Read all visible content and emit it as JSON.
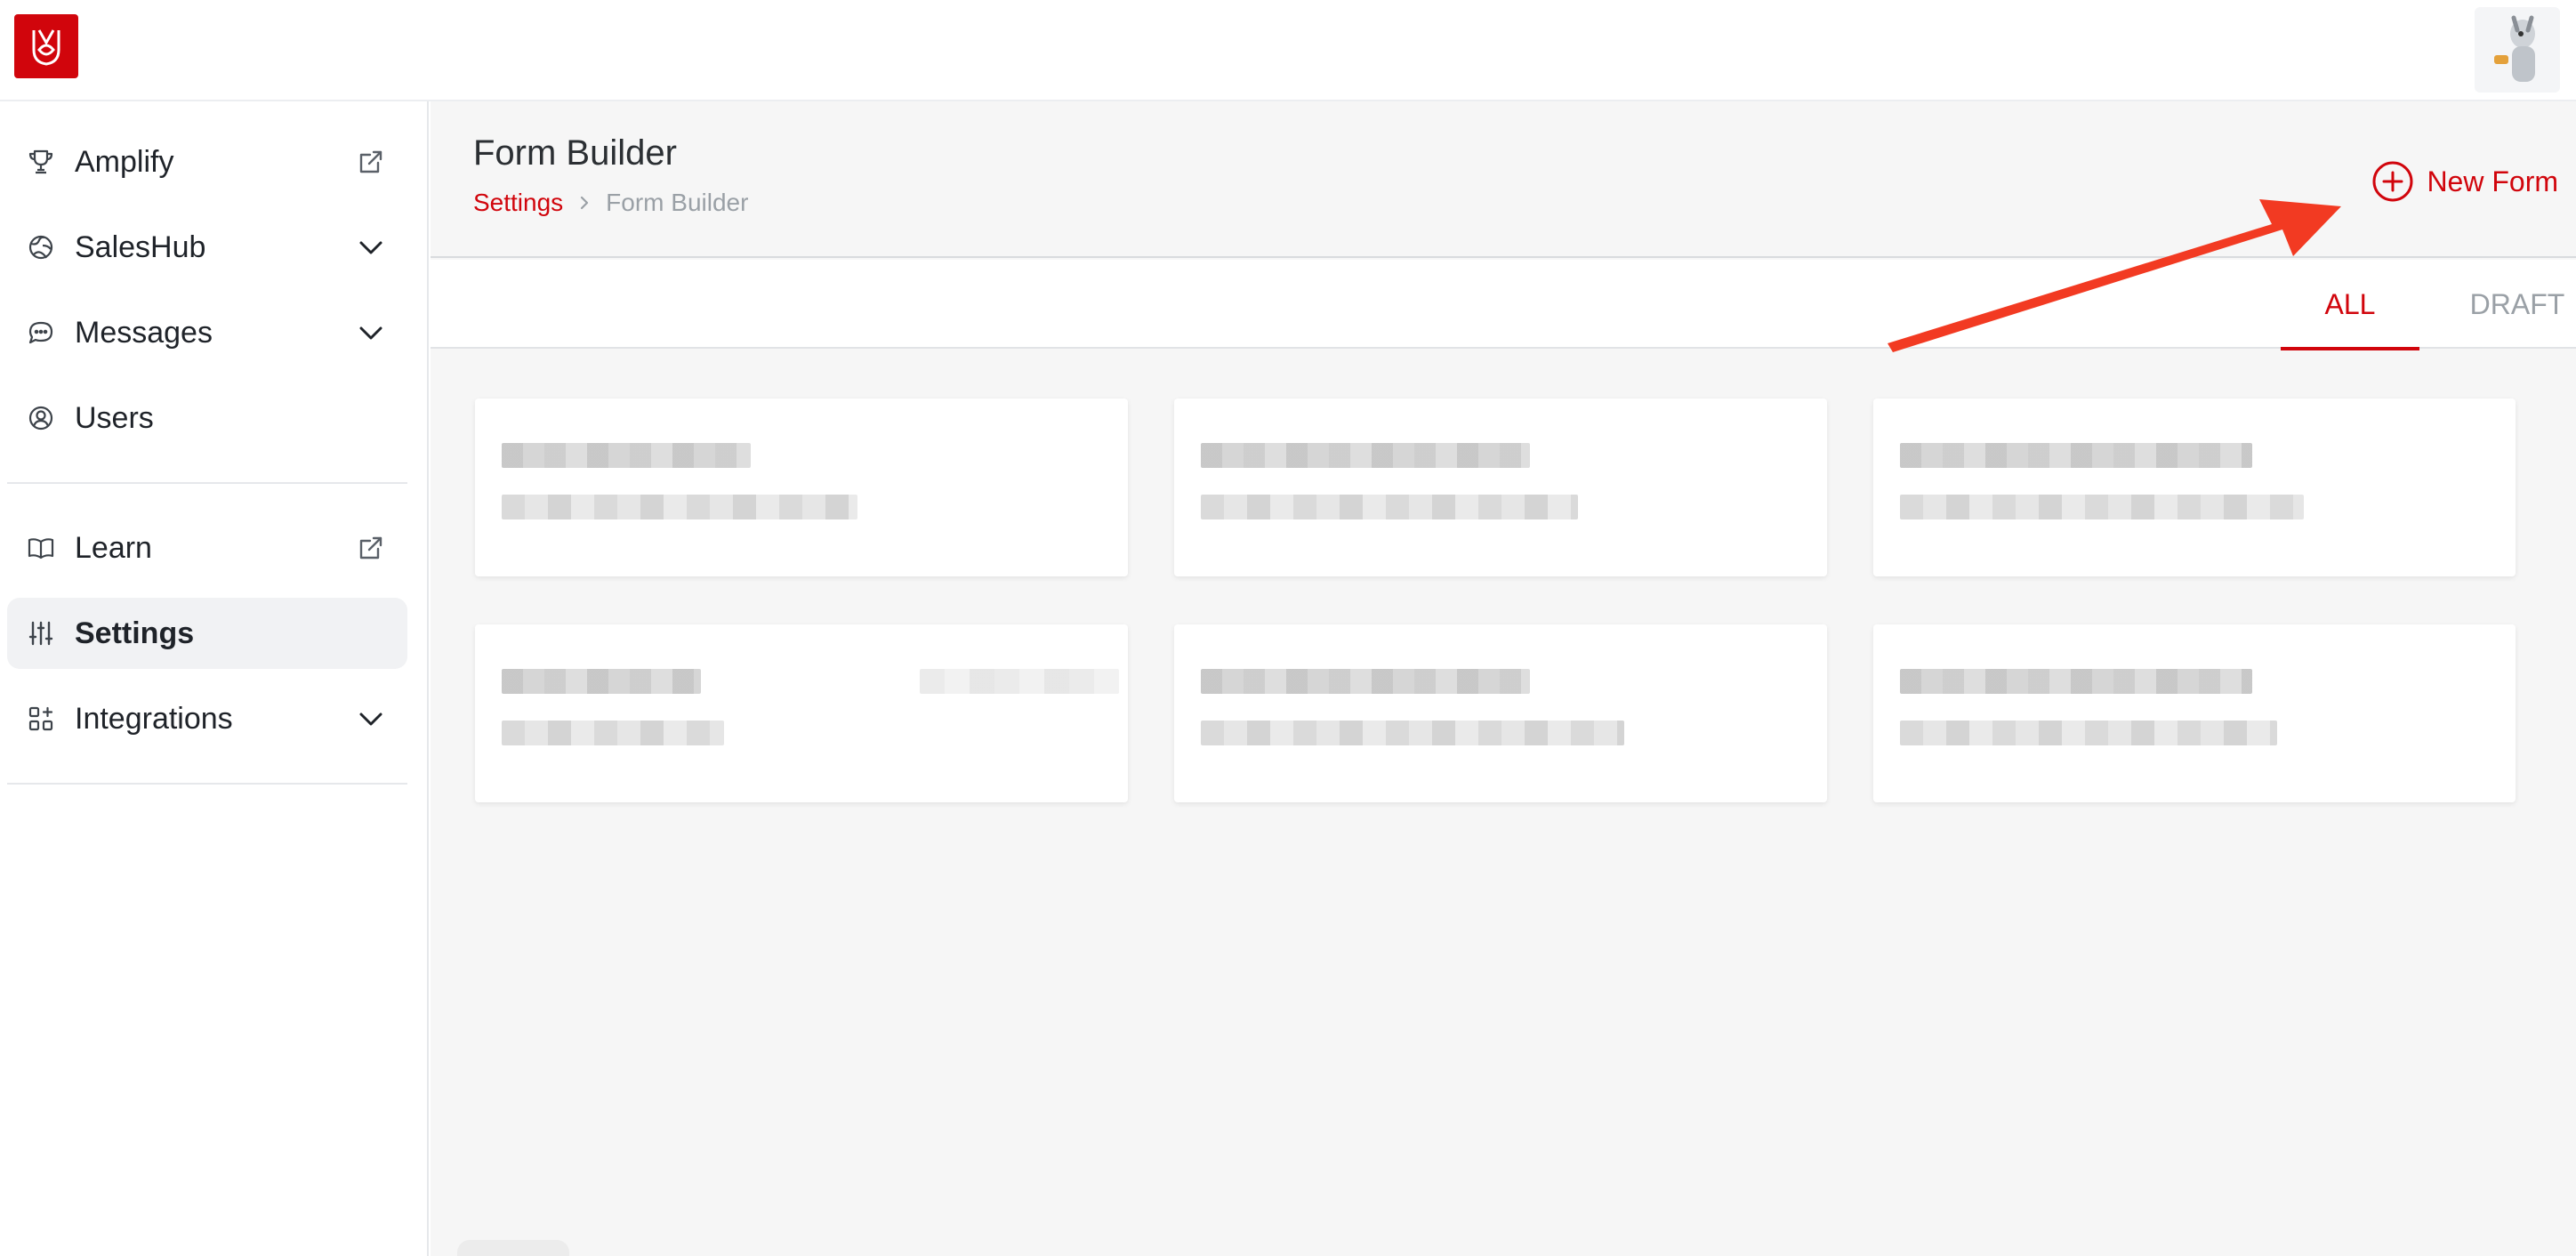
{
  "app": {
    "logo_icon": "company-logo-icon",
    "avatar_icon": "user-avatar-icon",
    "accent_color": "#d1050c"
  },
  "sidebar": {
    "items": [
      {
        "label": "Amplify",
        "icon": "trophy-icon",
        "trail": "external-link-icon"
      },
      {
        "label": "SalesHub",
        "icon": "globe-icon",
        "trail": "chevron-down-icon"
      },
      {
        "label": "Messages",
        "icon": "chat-bubble-icon",
        "trail": "chevron-down-icon"
      },
      {
        "label": "Users",
        "icon": "user-circle-icon",
        "trail": ""
      },
      {
        "label": "Learn",
        "icon": "book-icon",
        "trail": "external-link-icon"
      },
      {
        "label": "Settings",
        "icon": "sliders-icon",
        "trail": "",
        "active": true
      },
      {
        "label": "Integrations",
        "icon": "grid-plus-icon",
        "trail": "chevron-down-icon"
      }
    ]
  },
  "header": {
    "title": "Form Builder",
    "breadcrumb": {
      "parent": "Settings",
      "current": "Form Builder"
    },
    "new_form_label": "New Form"
  },
  "tabs": [
    {
      "label": "ALL",
      "active": true
    },
    {
      "label": "DRAFT",
      "active": false
    }
  ],
  "cards": {
    "count": 6,
    "content": "blurred"
  }
}
